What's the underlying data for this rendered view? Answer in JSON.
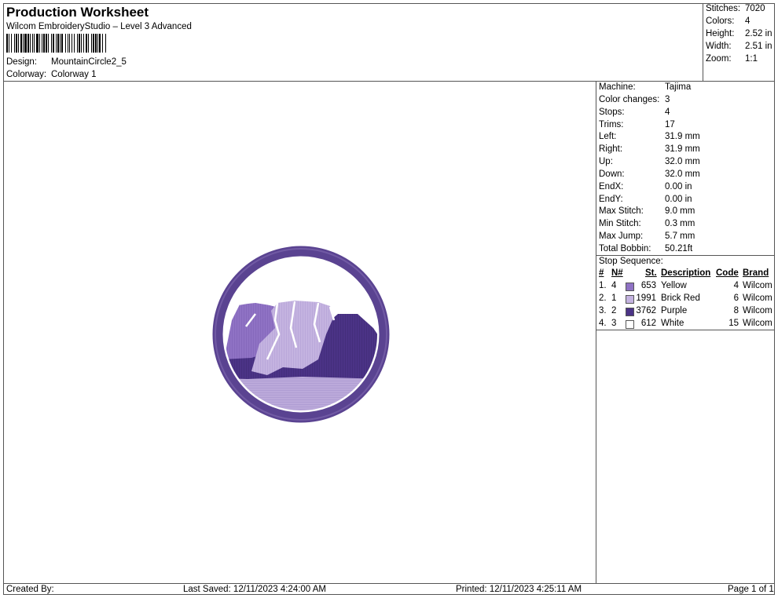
{
  "header": {
    "title": "Production Worksheet",
    "software": "Wilcom EmbroideryStudio – Level 3 Advanced",
    "design_label": "Design:",
    "design_value": "MountainCircle2_5",
    "colorway_label": "Colorway:",
    "colorway_value": "Colorway 1"
  },
  "summary": [
    {
      "label": "Stitches:",
      "value": "7020"
    },
    {
      "label": "Colors:",
      "value": "4"
    },
    {
      "label": "Height:",
      "value": "2.52 in"
    },
    {
      "label": "Width:",
      "value": "2.51 in"
    },
    {
      "label": "Zoom:",
      "value": "1:1"
    }
  ],
  "machine_info": [
    {
      "label": "Machine:",
      "value": "Tajima"
    },
    {
      "label": "Color changes:",
      "value": "3"
    },
    {
      "label": "Stops:",
      "value": "4"
    },
    {
      "label": "Trims:",
      "value": "17"
    },
    {
      "label": "Left:",
      "value": "31.9 mm"
    },
    {
      "label": "Right:",
      "value": "31.9 mm"
    },
    {
      "label": "Up:",
      "value": "32.0 mm"
    },
    {
      "label": "Down:",
      "value": "32.0 mm"
    },
    {
      "label": "EndX:",
      "value": "0.00 in"
    },
    {
      "label": "EndY:",
      "value": "0.00 in"
    },
    {
      "label": "Max Stitch:",
      "value": "9.0 mm"
    },
    {
      "label": "Min Stitch:",
      "value": "0.3 mm"
    },
    {
      "label": "Max Jump:",
      "value": "5.7 mm"
    },
    {
      "label": "Total Bobbin:",
      "value": "50.21ft"
    }
  ],
  "stop_sequence": {
    "title": "Stop Sequence:",
    "headers": {
      "num": "#",
      "n": "N#",
      "st": "St.",
      "description": "Description",
      "code": "Code",
      "brand": "Brand"
    },
    "rows": [
      {
        "num": "1.",
        "n": "4",
        "st": "653",
        "description": "Yellow",
        "code": "4",
        "brand": "Wilcom",
        "color": "#8f72c4"
      },
      {
        "num": "2.",
        "n": "1",
        "st": "1991",
        "description": "Brick Red",
        "code": "6",
        "brand": "Wilcom",
        "color": "#c4b3e0"
      },
      {
        "num": "3.",
        "n": "2",
        "st": "3762",
        "description": "Purple",
        "code": "8",
        "brand": "Wilcom",
        "color": "#4b3386"
      },
      {
        "num": "4.",
        "n": "3",
        "st": "612",
        "description": "White",
        "code": "15",
        "brand": "Wilcom",
        "color": "#ffffff"
      }
    ]
  },
  "footer": {
    "created_by": "Created By:",
    "last_saved": "Last Saved: 12/11/2023 4:24:00 AM",
    "printed": "Printed: 12/11/2023 4:25:11 AM",
    "page": "Page 1 of 1"
  },
  "colors": {
    "ring": "#5a4391",
    "ring_light": "#7a64ad",
    "mountain_dark": "#4b3386",
    "mountain_mid": "#8f72c4",
    "mountain_light": "#c4b3e0",
    "ground": "#b8a6d8",
    "highlight": "#ffffff"
  }
}
